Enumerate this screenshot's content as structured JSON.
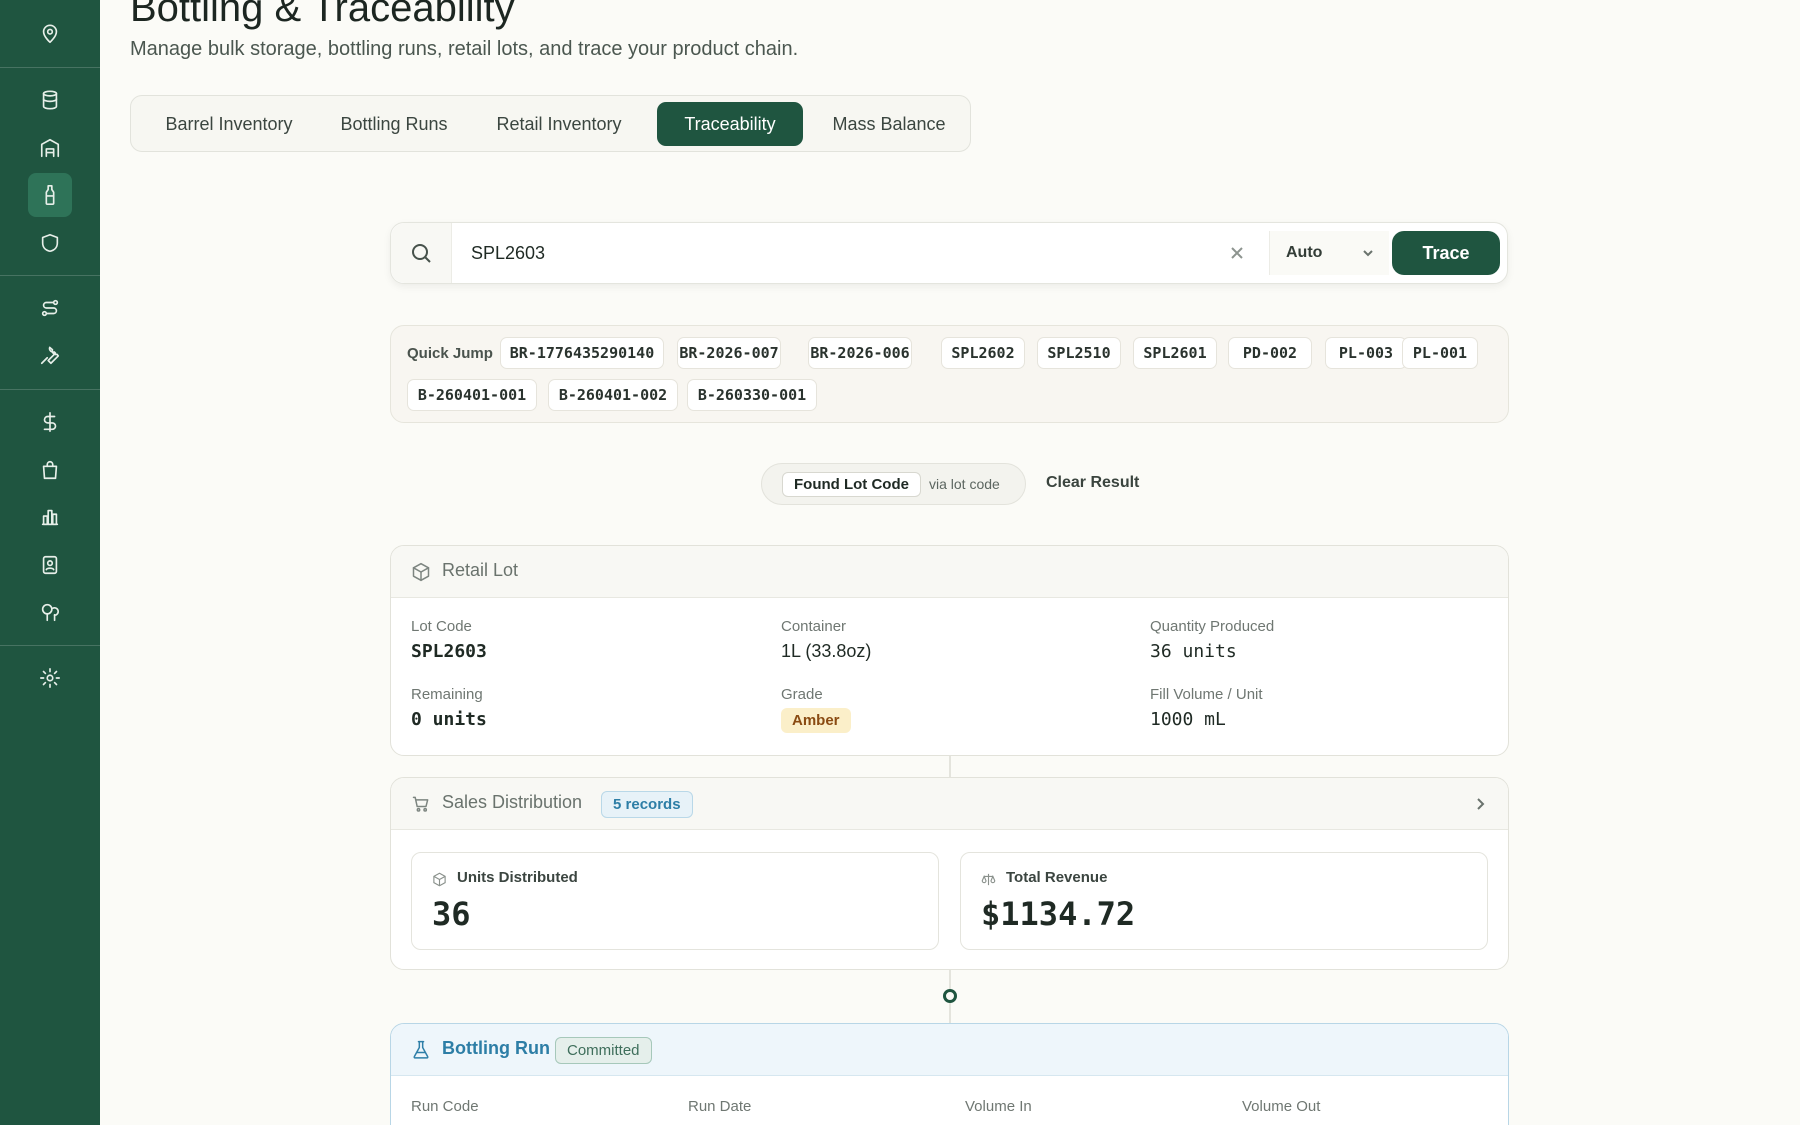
{
  "header": {
    "title": "Bottling & Traceability",
    "subtitle": "Manage bulk storage, bottling runs, retail lots, and trace your product chain."
  },
  "sidebar": {
    "icons": [
      "map-pin-icon",
      "barrel-icon",
      "warehouse-icon",
      "bottle-icon",
      "shield-icon",
      "route-icon",
      "wrench-icon",
      "dollar-icon",
      "shopping-bag-icon",
      "chart-icon",
      "contacts-icon",
      "trees-icon",
      "gear-icon"
    ],
    "active": "bottle-icon"
  },
  "tabs": [
    {
      "label": "Barrel Inventory"
    },
    {
      "label": "Bottling Runs"
    },
    {
      "label": "Retail Inventory"
    },
    {
      "label": "Traceability"
    },
    {
      "label": "Mass Balance"
    }
  ],
  "active_tab": "Traceability",
  "search": {
    "value": "SPL2603",
    "mode": "Auto",
    "button_label": "Trace"
  },
  "quick_jump": {
    "label": "Quick Jump",
    "items": [
      "BR-1776435290140",
      "BR-2026-007",
      "BR-2026-006",
      "SPL2602",
      "SPL2510",
      "SPL2601",
      "PD-002",
      "PL-003",
      "PL-001",
      "B-260401-001",
      "B-260401-002",
      "B-260330-001"
    ]
  },
  "result": {
    "found_label": "Found Lot Code",
    "via_label": "via lot code",
    "clear_label": "Clear Result"
  },
  "retail_lot": {
    "title": "Retail Lot",
    "fields": [
      {
        "label": "Lot Code",
        "value": "SPL2603"
      },
      {
        "label": "Container",
        "value": "1L (33.8oz)"
      },
      {
        "label": "Quantity Produced",
        "value": "36 units"
      },
      {
        "label": "Remaining",
        "value": "0 units"
      },
      {
        "label": "Grade",
        "value": "Amber"
      },
      {
        "label": "Fill Volume / Unit",
        "value": "1000 mL"
      }
    ]
  },
  "sales": {
    "title": "Sales Distribution",
    "records_badge": "5 records",
    "units_label": "Units Distributed",
    "units_value": "36",
    "revenue_label": "Total Revenue",
    "revenue_value": "$1134.72"
  },
  "bottling_run": {
    "title": "Bottling Run",
    "status": "Committed",
    "columns": [
      "Run Code",
      "Run Date",
      "Volume In",
      "Volume Out"
    ]
  },
  "colors": {
    "sidebar": "#1f5540",
    "accent": "#1f5540",
    "info": "#2d7ea6",
    "grade_bg": "#fbefc9"
  }
}
